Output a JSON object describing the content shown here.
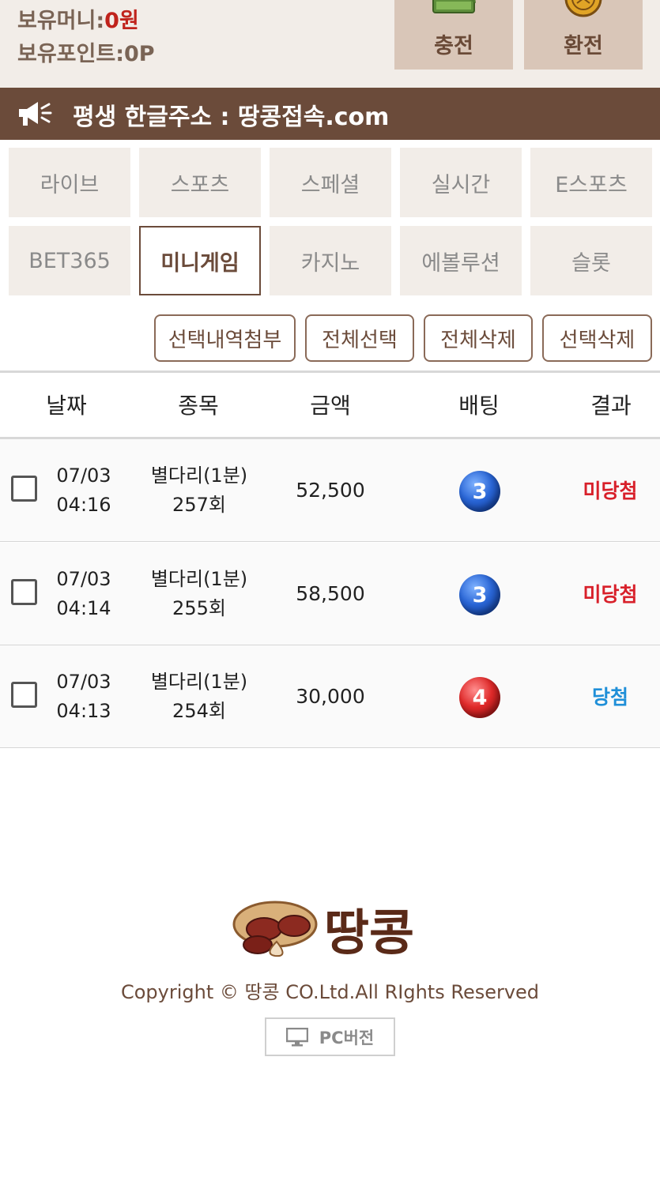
{
  "balance": {
    "money_label": "보유머니:",
    "money_value": "0원",
    "point_label": "보유포인트:",
    "point_value": "0P"
  },
  "top_buttons": {
    "charge": "충전",
    "exchange": "환전"
  },
  "notice": {
    "text": "평생 한글주소 : 땅콩접속.com"
  },
  "categories": {
    "row1": [
      "라이브",
      "스포츠",
      "스페셜",
      "실시간",
      "E스포츠"
    ],
    "row2": [
      "BET365",
      "미니게임",
      "카지노",
      "에볼루션",
      "슬롯"
    ],
    "active": "미니게임"
  },
  "actions": {
    "attach": "선택내역첨부",
    "select_all": "전체선택",
    "delete_all": "전체삭제",
    "delete_selected": "선택삭제"
  },
  "table": {
    "headers": {
      "date": "날짜",
      "game": "종목",
      "amount": "금액",
      "bet": "배팅",
      "result": "결과"
    },
    "rows": [
      {
        "date": "07/03",
        "time": "04:16",
        "game": "별다리(1분)",
        "round": "257회",
        "amount": "52,500",
        "bet": "3",
        "bet_color": "blue",
        "result": "미당첨",
        "result_type": "lose"
      },
      {
        "date": "07/03",
        "time": "04:14",
        "game": "별다리(1분)",
        "round": "255회",
        "amount": "58,500",
        "bet": "3",
        "bet_color": "blue",
        "result": "미당첨",
        "result_type": "lose"
      },
      {
        "date": "07/03",
        "time": "04:13",
        "game": "별다리(1분)",
        "round": "254회",
        "amount": "30,000",
        "bet": "4",
        "bet_color": "red",
        "result": "당첨",
        "result_type": "win"
      }
    ]
  },
  "footer": {
    "logo_text": "땅콩",
    "copyright": "Copyright © 땅콩 CO.Ltd.All RIghts Reserved",
    "pc_version": "PC버전"
  },
  "colors": {
    "brand_brown": "#6b4b3a",
    "lose_red": "#d8202a",
    "win_blue": "#1f8fd8",
    "money_red": "#c0231c"
  }
}
